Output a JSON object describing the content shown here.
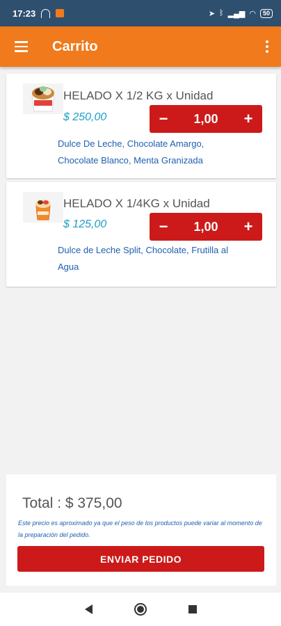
{
  "status_bar": {
    "time": "17:23",
    "battery": "50"
  },
  "app_bar": {
    "title": "Carrito"
  },
  "cart_items": [
    {
      "name": "HELADO X 1/2 KG x Unidad",
      "price": "$ 250,00",
      "quantity": "1,00",
      "flavors": "Dulce De Leche, Chocolate Amargo, Chocolate Blanco, Menta Granizada"
    },
    {
      "name": "HELADO X 1/4KG x Unidad",
      "price": "$ 125,00",
      "quantity": "1,00",
      "flavors": "Dulce de Leche Split, Chocolate, Frutilla al Agua"
    }
  ],
  "stepper": {
    "minus": "−",
    "plus": "+"
  },
  "summary": {
    "total": "Total : $ 375,00",
    "disclaimer": "Este precio es aproximado ya que el peso de los productos puede variar al momento de la preparación del pedido.",
    "send_label": "ENVIAR PEDIDO"
  },
  "colors": {
    "accent": "#f07a1c",
    "primary_button": "#cc1a1a",
    "status_bar": "#2f4f6f",
    "price": "#1a9ec9",
    "flavor_text": "#1f5fb0"
  }
}
